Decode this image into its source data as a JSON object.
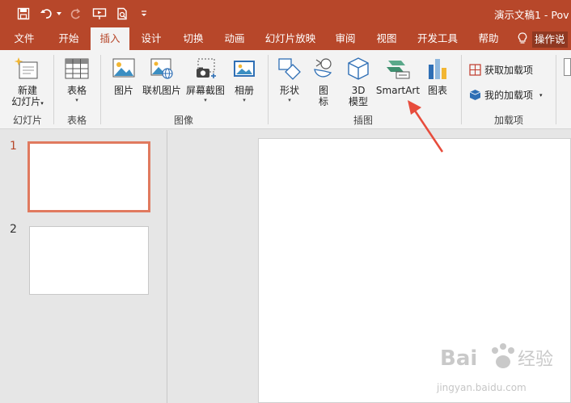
{
  "window": {
    "title": "演示文稿1 - Pov"
  },
  "tabs": [
    "文件",
    "开始",
    "插入",
    "设计",
    "切换",
    "动画",
    "幻灯片放映",
    "审阅",
    "视图",
    "开发工具",
    "帮助"
  ],
  "active_tab": "插入",
  "tell_me": "操作说",
  "ribbon": {
    "new_slide": {
      "line1": "新建",
      "line2": "幻灯片"
    },
    "table": "表格",
    "picture": "图片",
    "online_picture": "联机图片",
    "screenshot": "屏幕截图",
    "album": "相册",
    "shapes": "形状",
    "icons": {
      "line1": "图",
      "line2": "标"
    },
    "model3d": {
      "line1": "3D",
      "line2": "模型"
    },
    "smartart": "SmartArt",
    "chart": "图表",
    "get_addins": "获取加载项",
    "my_addins": "我的加载项",
    "groups": {
      "slides": "幻灯片",
      "tables": "表格",
      "images": "图像",
      "illustrations": "插图",
      "addins": "加载项"
    }
  },
  "thumbnails": [
    {
      "number": "1",
      "selected": true
    },
    {
      "number": "2",
      "selected": false
    }
  ],
  "watermark": {
    "brand": "Baidu经验",
    "url": "jingyan.baidu.com"
  },
  "colors": {
    "accent": "#b7472a",
    "ribbon_bg": "#f3f3f3",
    "arrow": "#e74c3c",
    "selected_border": "#e07a5f"
  }
}
